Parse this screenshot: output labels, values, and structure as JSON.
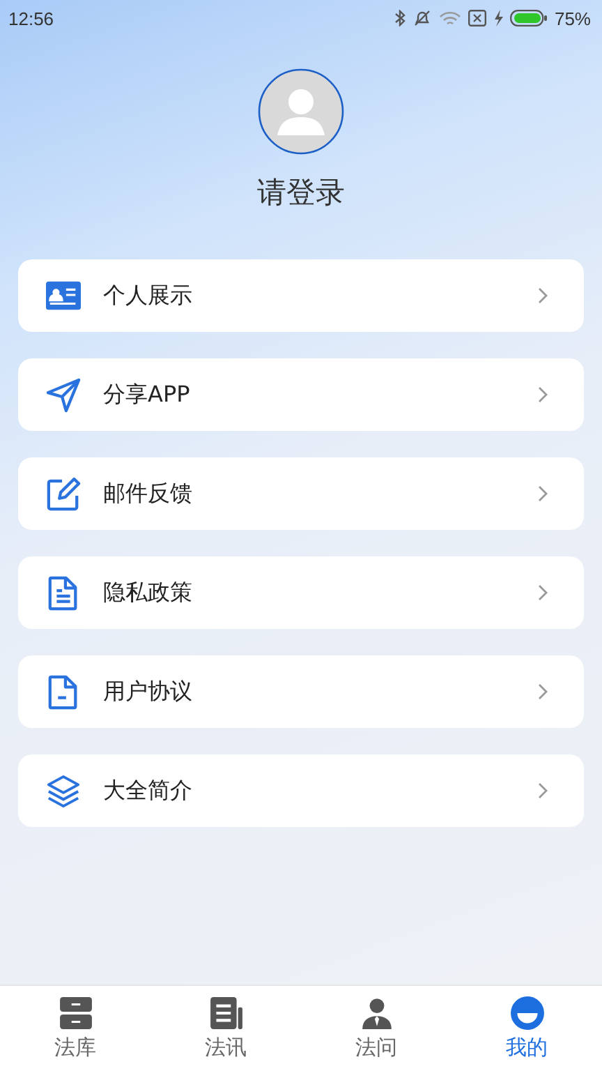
{
  "status_bar": {
    "time": "12:56",
    "battery": "75%"
  },
  "profile": {
    "login": "请登录"
  },
  "menu": [
    {
      "kind": "card",
      "label": "个人展示"
    },
    {
      "kind": "send",
      "label": "分享APP"
    },
    {
      "kind": "edit",
      "label": "邮件反馈"
    },
    {
      "kind": "doc",
      "label": "隐私政策"
    },
    {
      "kind": "doc-minus",
      "label": "用户协议"
    },
    {
      "kind": "layers",
      "label": "大全简介"
    }
  ],
  "tabs": [
    {
      "kind": "cabinet",
      "label": "法库",
      "selected": false
    },
    {
      "kind": "news",
      "label": "法讯",
      "selected": false
    },
    {
      "kind": "person",
      "label": "法问",
      "selected": false
    },
    {
      "kind": "me",
      "label": "我的",
      "selected": true
    }
  ]
}
